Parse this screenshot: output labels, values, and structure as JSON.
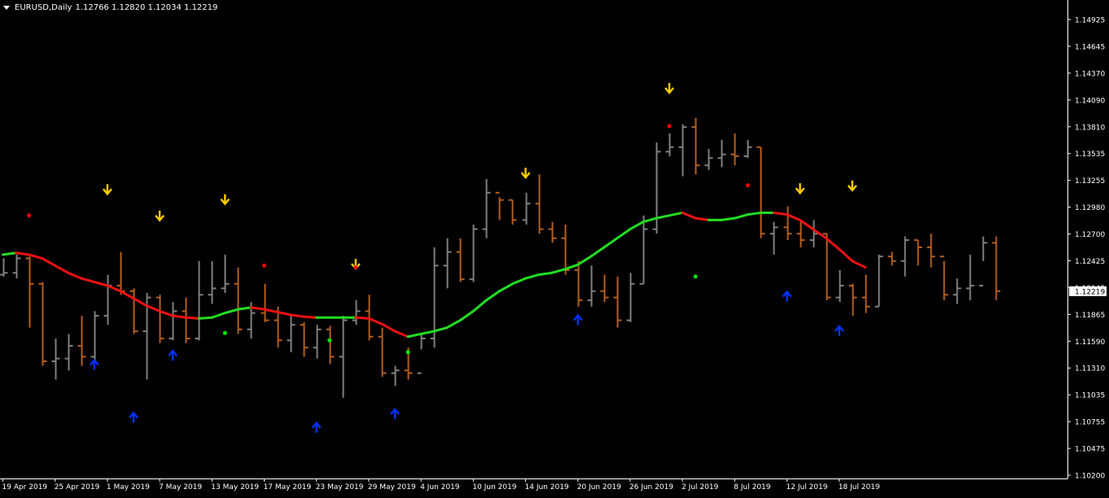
{
  "window": {
    "symbol": "EURUSD,Daily",
    "ohlc": "1.12766 1.12820 1.12034 1.12219"
  },
  "current_price_label": "1.12219",
  "chart_data": {
    "type": "ohlc",
    "title": "EURUSD,Daily",
    "ylim": [
      1.102,
      1.152
    ],
    "yticks": [
      "1.14925",
      "1.14645",
      "1.14370",
      "1.14090",
      "1.13810",
      "1.13535",
      "1.13255",
      "1.12980",
      "1.12700",
      "1.12425",
      "1.12145",
      "1.11865",
      "1.11590",
      "1.11310",
      "1.11035",
      "1.10755",
      "1.10475",
      "1.10200"
    ],
    "xticks": [
      "19 Apr 2019",
      "25 Apr 2019",
      "1 May 2019",
      "7 May 2019",
      "13 May 2019",
      "17 May 2019",
      "23 May 2019",
      "29 May 2019",
      "4 Jun 2019",
      "10 Jun 2019",
      "14 Jun 2019",
      "20 Jun 2019",
      "26 Jun 2019",
      "2 Jul 2019",
      "8 Jul 2019",
      "12 Jul 2019",
      "18 Jul 2019"
    ],
    "xtick_index": [
      0,
      4,
      8,
      12,
      16,
      20,
      24,
      28,
      32,
      36,
      40,
      44,
      48,
      52,
      56,
      60,
      64
    ],
    "bars": [
      [
        1.124,
        1.1258,
        1.1238,
        1.1242
      ],
      [
        1.1242,
        1.1262,
        1.1236,
        1.1258
      ],
      [
        1.1258,
        1.126,
        1.1182,
        1.123
      ],
      [
        1.123,
        1.1232,
        1.114,
        1.1145
      ],
      [
        1.1145,
        1.117,
        1.1125,
        1.1148
      ],
      [
        1.1148,
        1.1175,
        1.1135,
        1.1162
      ],
      [
        1.1162,
        1.1195,
        1.114,
        1.115
      ],
      [
        1.115,
        1.12,
        1.1145,
        1.1195
      ],
      [
        1.1195,
        1.124,
        1.1185,
        1.1228
      ],
      [
        1.1228,
        1.1265,
        1.1218,
        1.1222
      ],
      [
        1.1222,
        1.1225,
        1.1175,
        1.1178
      ],
      [
        1.1178,
        1.122,
        1.1125,
        1.1215
      ],
      [
        1.1215,
        1.1218,
        1.1165,
        1.117
      ],
      [
        1.117,
        1.121,
        1.1168,
        1.12
      ],
      [
        1.12,
        1.1215,
        1.1165,
        1.117
      ],
      [
        1.117,
        1.1255,
        1.1168,
        1.1218
      ],
      [
        1.1218,
        1.1255,
        1.1208,
        1.1225
      ],
      [
        1.1225,
        1.1262,
        1.122,
        1.123
      ],
      [
        1.123,
        1.1248,
        1.1175,
        1.118
      ],
      [
        1.118,
        1.121,
        1.117,
        1.1198
      ],
      [
        1.1198,
        1.123,
        1.1188,
        1.119
      ],
      [
        1.119,
        1.1205,
        1.116,
        1.1168
      ],
      [
        1.1168,
        1.1195,
        1.1155,
        1.1185
      ],
      [
        1.1185,
        1.1188,
        1.115,
        1.116
      ],
      [
        1.116,
        1.1185,
        1.1148,
        1.118
      ],
      [
        1.118,
        1.1184,
        1.1142,
        1.115
      ],
      [
        1.115,
        1.1195,
        1.1105,
        1.119
      ],
      [
        1.119,
        1.1212,
        1.1185,
        1.12
      ],
      [
        1.12,
        1.1218,
        1.1168,
        1.1172
      ],
      [
        1.1172,
        1.1182,
        1.1128,
        1.1132
      ],
      [
        1.1132,
        1.114,
        1.1118,
        1.1135
      ],
      [
        1.1135,
        1.116,
        1.1125,
        1.1132
      ],
      [
        1.1132,
        1.1175,
        1.1158,
        1.117
      ],
      [
        1.117,
        1.127,
        1.116,
        1.125
      ],
      [
        1.125,
        1.128,
        1.1225,
        1.1265
      ],
      [
        1.1265,
        1.128,
        1.1232,
        1.1235
      ],
      [
        1.1235,
        1.1295,
        1.1232,
        1.129
      ],
      [
        1.129,
        1.1345,
        1.128,
        1.133
      ],
      [
        1.133,
        1.1325,
        1.13,
        1.1322
      ],
      [
        1.1322,
        1.1322,
        1.1295,
        1.13
      ],
      [
        1.13,
        1.133,
        1.1295,
        1.1318
      ],
      [
        1.1318,
        1.135,
        1.1285,
        1.129
      ],
      [
        1.129,
        1.1298,
        1.1275,
        1.128
      ],
      [
        1.128,
        1.1295,
        1.124,
        1.1245
      ],
      [
        1.1245,
        1.1255,
        1.1205,
        1.1212
      ],
      [
        1.1212,
        1.125,
        1.1205,
        1.1222
      ],
      [
        1.1222,
        1.124,
        1.121,
        1.1215
      ],
      [
        1.1215,
        1.1238,
        1.1182,
        1.119
      ],
      [
        1.119,
        1.1242,
        1.1188,
        1.123
      ],
      [
        1.123,
        1.1305,
        1.123,
        1.129
      ],
      [
        1.129,
        1.1385,
        1.1285,
        1.1375
      ],
      [
        1.1375,
        1.1395,
        1.137,
        1.138
      ],
      [
        1.138,
        1.1405,
        1.1348,
        1.1402
      ],
      [
        1.1402,
        1.1412,
        1.135,
        1.136
      ],
      [
        1.136,
        1.1378,
        1.1355,
        1.1368
      ],
      [
        1.1368,
        1.1388,
        1.1358,
        1.1372
      ],
      [
        1.1372,
        1.1395,
        1.136,
        1.137
      ],
      [
        1.137,
        1.1388,
        1.1368,
        1.138
      ],
      [
        1.138,
        1.138,
        1.128,
        1.1285
      ],
      [
        1.1285,
        1.1298,
        1.1262,
        1.1292
      ],
      [
        1.1292,
        1.1315,
        1.1278,
        1.1285
      ],
      [
        1.1285,
        1.13,
        1.127,
        1.1278
      ],
      [
        1.1278,
        1.13,
        1.127,
        1.1285
      ],
      [
        1.1285,
        1.1285,
        1.1212,
        1.1215
      ],
      [
        1.1215,
        1.1245,
        1.121,
        1.1228
      ],
      [
        1.1228,
        1.123,
        1.1195,
        1.1215
      ],
      [
        1.1215,
        1.124,
        1.1198,
        1.1205
      ],
      [
        1.1205,
        1.1262,
        1.1205,
        1.126
      ],
      [
        1.126,
        1.1265,
        1.125,
        1.1255
      ],
      [
        1.1255,
        1.1282,
        1.1238,
        1.1278
      ],
      [
        1.1278,
        1.1278,
        1.125,
        1.127
      ],
      [
        1.127,
        1.1285,
        1.1248,
        1.126
      ],
      [
        1.126,
        1.1255,
        1.1212,
        1.1218
      ],
      [
        1.1218,
        1.1236,
        1.1208,
        1.1225
      ],
      [
        1.1225,
        1.1262,
        1.1212,
        1.1228
      ],
      [
        1.1228,
        1.1282,
        1.1255,
        1.1275
      ],
      [
        1.1275,
        1.1282,
        1.1212,
        1.1222
      ]
    ],
    "bar_colors": {
      "bear": "#B45F1E",
      "bull": "#808080"
    },
    "ma_line": [
      1.1262,
      1.1264,
      1.1262,
      1.1258,
      1.125,
      1.1242,
      1.1236,
      1.1232,
      1.1228,
      1.1222,
      1.1214,
      1.1206,
      1.12,
      1.1195,
      1.1193,
      1.1192,
      1.1193,
      1.1198,
      1.1202,
      1.1204,
      1.1202,
      1.1199,
      1.1196,
      1.1194,
      1.1193,
      1.1193,
      1.1193,
      1.1193,
      1.1192,
      1.1186,
      1.1178,
      1.1172,
      1.1175,
      1.1178,
      1.1182,
      1.119,
      1.12,
      1.1212,
      1.1222,
      1.123,
      1.1236,
      1.124,
      1.1242,
      1.1246,
      1.1251,
      1.126,
      1.127,
      1.128,
      1.129,
      1.1298,
      1.1302,
      1.1305,
      1.1308,
      1.1302,
      1.13,
      1.13,
      1.1302,
      1.1306,
      1.1308,
      1.1308,
      1.1306,
      1.13,
      1.129,
      1.128,
      1.1268,
      1.1255,
      1.1248
    ],
    "ma_colors": {
      "up": "#22DD22",
      "down": "#EE1111"
    },
    "up_arrows": [
      [
        7,
        1.1141
      ],
      [
        10,
        1.1083
      ],
      [
        13,
        1.1151
      ],
      [
        24,
        1.1072
      ],
      [
        30,
        1.1087
      ],
      [
        44,
        1.119
      ],
      [
        60,
        1.1216
      ],
      [
        64,
        1.1178
      ]
    ],
    "down_arrows": [
      [
        8,
        1.1334
      ],
      [
        12,
        1.1305
      ],
      [
        17,
        1.1323
      ],
      [
        27,
        1.1252
      ],
      [
        40,
        1.1352
      ],
      [
        51,
        1.1445
      ],
      [
        61,
        1.1335
      ],
      [
        65,
        1.1338
      ]
    ],
    "red_dots": [
      [
        2,
        1.1305
      ],
      [
        20,
        1.125
      ],
      [
        27,
        1.1248
      ],
      [
        51,
        1.1403
      ],
      [
        57,
        1.1338
      ]
    ],
    "green_dots": [
      [
        17,
        1.1176
      ],
      [
        25,
        1.1168
      ],
      [
        31,
        1.1155
      ],
      [
        53,
        1.1238
      ]
    ],
    "colors": {
      "up_arrow": "#0033FF",
      "down_arrow": "#FFCC00",
      "red_dot": "#FF0000",
      "green_dot": "#00EE00",
      "axis": "#FFFFFF"
    }
  }
}
